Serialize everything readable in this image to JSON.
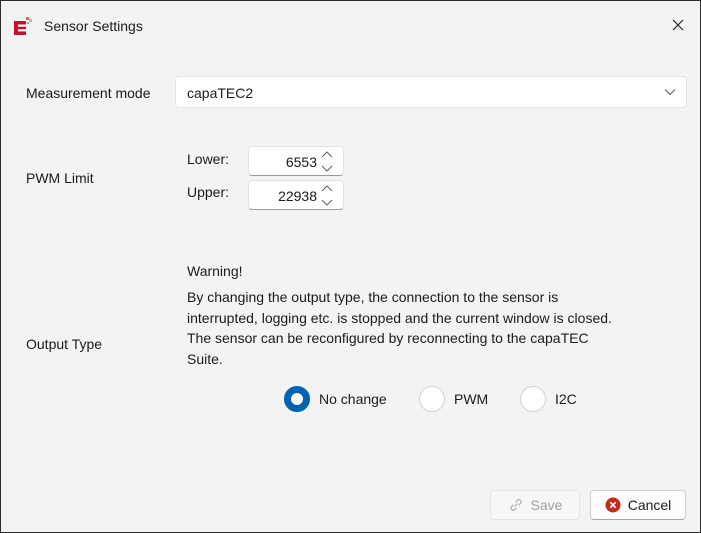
{
  "window": {
    "title": "Sensor Settings",
    "app_icon": "capatec-e-icon",
    "close_icon": "close-icon"
  },
  "measurement": {
    "label": "Measurement mode",
    "selected": "capaTEC2"
  },
  "pwm_limit": {
    "label": "PWM Limit",
    "lower_label": "Lower:",
    "lower_value": "6553",
    "upper_label": "Upper:",
    "upper_value": "22938"
  },
  "output_type": {
    "label": "Output Type",
    "warning_title": "Warning!",
    "warning_lines": [
      "By changing the output type, the connection to the sensor is",
      "interrupted, logging etc. is stopped and the current window is closed.",
      "The sensor can be reconfigured by reconnecting to the capaTEC",
      "Suite."
    ],
    "options": [
      {
        "label": "No change",
        "selected": true
      },
      {
        "label": "PWM",
        "selected": false
      },
      {
        "label": "I2C",
        "selected": false
      }
    ]
  },
  "buttons": {
    "save_label": "Save",
    "save_enabled": false,
    "cancel_label": "Cancel"
  },
  "colors": {
    "accent": "#0063b1",
    "cancel_icon": "#c42b1c",
    "brand": "#c8102e"
  }
}
